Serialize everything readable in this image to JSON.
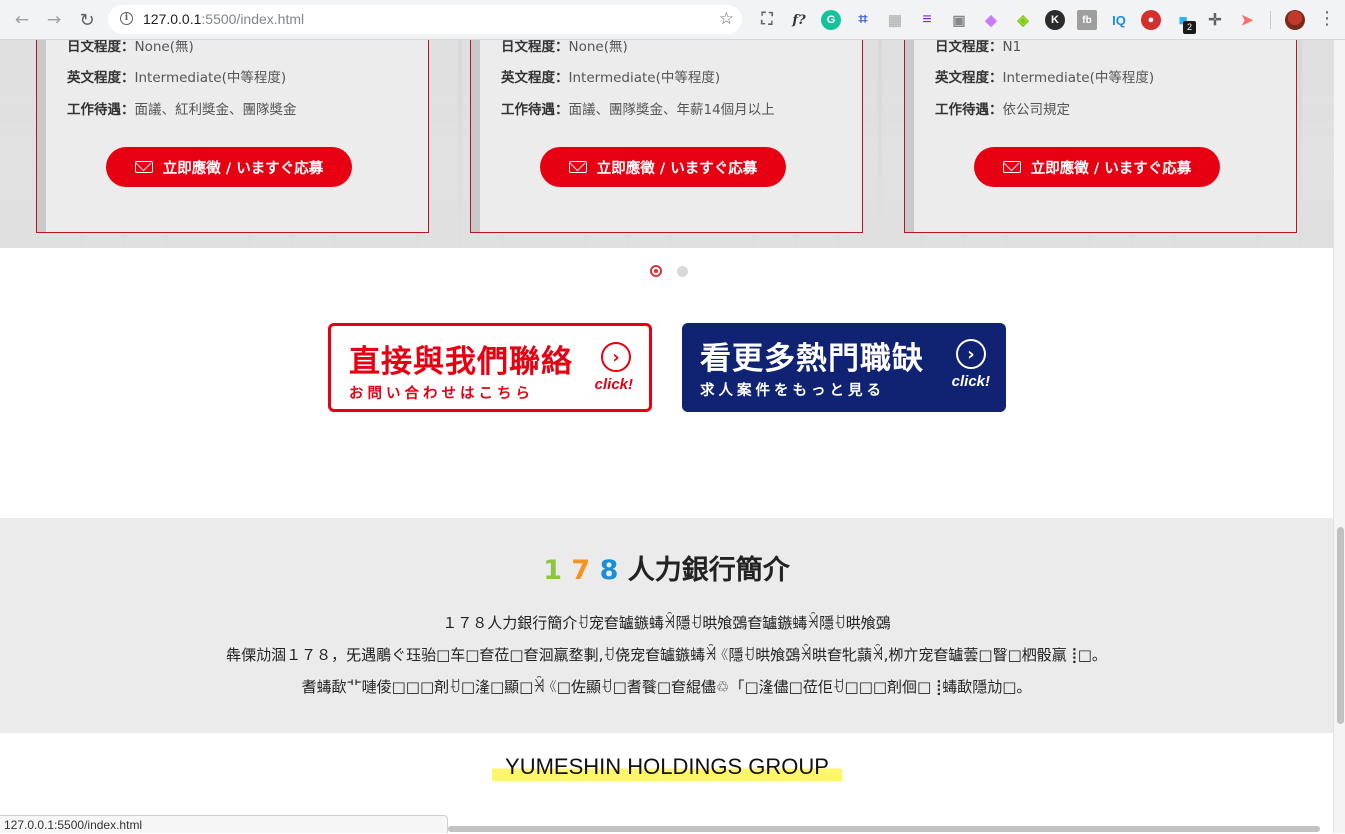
{
  "browser": {
    "url_host": "127.0.0.1",
    "url_rest": ":5500/index.html",
    "extension_badge": "2",
    "ext_labels": {
      "fx": "f?",
      "k": "K",
      "fb": "fb",
      "iq": "IQ"
    }
  },
  "jobs": {
    "cards": [
      {
        "row1_label": "日文程度：",
        "row1_value": "None(無)",
        "row2_label": "英文程度：",
        "row2_value": "Intermediate(中等程度)",
        "row3_label": "工作待遇：",
        "row3_value": "面議、紅利獎金、團隊獎金",
        "apply_label": "立即應徵 / いますぐ応募"
      },
      {
        "row1_label": "日文程度：",
        "row1_value": "None(無)",
        "row2_label": "英文程度：",
        "row2_value": "Intermediate(中等程度)",
        "row3_label": "工作待遇：",
        "row3_value": "面議、團隊獎金、年薪14個月以上",
        "apply_label": "立即應徵 / いますぐ応募"
      },
      {
        "row1_label": "日文程度：",
        "row1_value": "N1",
        "row2_label": "英文程度：",
        "row2_value": "Intermediate(中等程度)",
        "row3_label": "工作待遇：",
        "row3_value": "依公司規定",
        "apply_label": "立即應徵 / いますぐ応募"
      }
    ],
    "carousel_total": 2,
    "carousel_active": 1
  },
  "cta": {
    "contact": {
      "title": "直接與我們聯絡",
      "subtitle": "お問い合わせはこちら",
      "click": "click!"
    },
    "more": {
      "title": "看更多熱門職缺",
      "subtitle": "求人案件をもっと見る",
      "click": "click!"
    }
  },
  "intro": {
    "title_digits": [
      "1",
      "7",
      "8"
    ],
    "title_text": "人力銀行簡介",
    "lines": [
      "１７８人力銀行簡介ꀀ宠奆罏鏃蝳ꈀ隱ꀀ晎飧鵶奆罏鏃蝳ꈀ隱ꀀ晎飧鵶",
      "犇傈劥涸１７８，⺛遇鵰ぐ珏骀□车□奆莅□奆洄羸堥剚,ꀀ侥宠奆罏鏃蝳ꈀ《隱ꀀ晎飧鵶ꈀ晎奆牝蘏ꈀ,栁亣宠奆罏蕓□瞖□柶骰羸⢸□。",
      "耆蝳歃⻀嗹倰□□□剤ꀀ□湰□顯□ꈀ《□佐顯ꀀ□耆餮□奆緄儘♲「□湰儘□莅佢ꀀ□□□剤佪□⢸蝳歃隱劥□。"
    ]
  },
  "group": {
    "label": "YUMESHIN HOLDINGS GROUP"
  },
  "status": {
    "url": "127.0.0.1:5500/index.html"
  },
  "colors": {
    "brand_red": "#e60012",
    "brand_navy": "#102373",
    "highlight_yellow": "#fff56a"
  }
}
